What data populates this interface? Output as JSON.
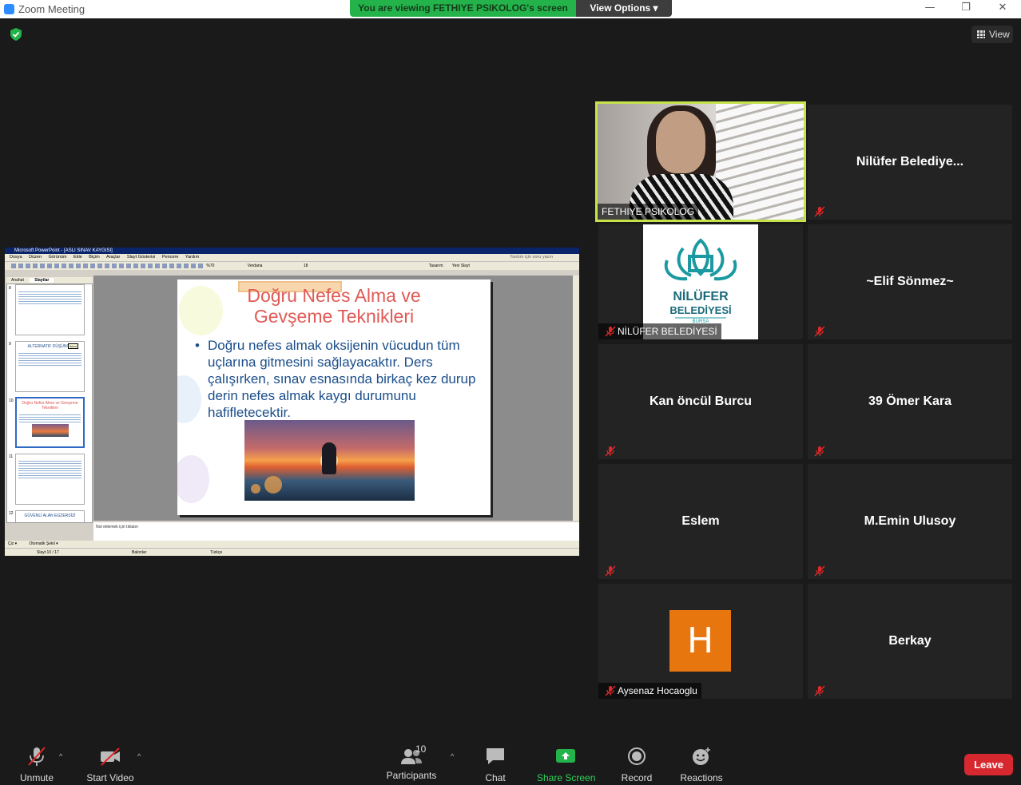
{
  "window": {
    "title": "Zoom Meeting",
    "minimize": "—",
    "restore": "❐",
    "close": "✕"
  },
  "banner": {
    "viewing": "You are viewing FETHIYE PSIKOLOG's screen",
    "view_options": "View Options ▾"
  },
  "top_right": {
    "view_label": "View"
  },
  "shared_screen": {
    "app_title": "Microsoft PowerPoint - [ASLI SINAV KAYGISI]",
    "menu": [
      "Dosya",
      "Düzen",
      "Görünüm",
      "Ekle",
      "Biçim",
      "Araçlar",
      "Slayt Gösterisi",
      "Pencere",
      "Yardım"
    ],
    "help_search": "Yardım için soru yazın",
    "toolbar_zoom": "%70",
    "toolbar_font": "Verdana",
    "toolbar_size": "18",
    "toolbar_design": "Tasarım",
    "toolbar_new_slide": "Yeni Slayt",
    "pane_tabs": [
      "Anahat",
      "Slaytlar"
    ],
    "thumbnails": [
      {
        "num": "8",
        "title": "",
        "red": false,
        "tooltip": ""
      },
      {
        "num": "9",
        "title": "ALTERNATIF DÜŞÜNCE",
        "red": false,
        "tooltip": "İkinci"
      },
      {
        "num": "10",
        "title": "Doğru Nefes Alma ve Gevşeme Teknikleri",
        "red": true,
        "tooltip": ""
      },
      {
        "num": "11",
        "title": "",
        "red": false,
        "tooltip": ""
      },
      {
        "num": "12",
        "title": "GÜVENLİ ALAN EGZERSİZİ",
        "red": false,
        "tooltip": ""
      }
    ],
    "slide": {
      "title_line1": "Doğru Nefes Alma ve",
      "title_line2": "Gevşeme Teknikleri",
      "bullet": "Doğru nefes almak oksijenin vücudun tüm uçlarına gitmesini sağlayacaktır. Ders çalışırken, sınav esnasında birkaç kez durup derin nefes almak kaygı durumunu hafifletecektir."
    },
    "notes_placeholder": "Not eklemek için tıklatın",
    "draw_bar": {
      "draw": "Çiz ▾",
      "autoshapes": "Otomatik Şekil ▾"
    },
    "status": {
      "slide": "Slayt 10 / 17",
      "design": "Balonlar",
      "language": "Türkçe"
    }
  },
  "participants_tiles": [
    {
      "name": "FETHIYE PSIKOLOG",
      "type": "video",
      "muted": false
    },
    {
      "name": "Nilüfer  Belediye...",
      "type": "name",
      "muted": true
    },
    {
      "name": "NİLÜFER BELEDİYESİ",
      "type": "logo",
      "muted": true,
      "logo_line1": "NİLÜFER",
      "logo_line2": "BELEDİYESİ",
      "logo_line3": "BURSA"
    },
    {
      "name": "~Elif Sönmez~",
      "type": "name",
      "muted": true
    },
    {
      "name": "Kan öncül Burcu",
      "type": "name",
      "muted": true
    },
    {
      "name": "39 Ömer Kara",
      "type": "name",
      "muted": true
    },
    {
      "name": "Eslem",
      "type": "name",
      "muted": true
    },
    {
      "name": "M.Emin Ulusoy",
      "type": "name",
      "muted": true
    },
    {
      "name": "Aysenaz Hocaoglu",
      "type": "avatar",
      "muted": true,
      "initial": "H"
    },
    {
      "name": "Berkay",
      "type": "name",
      "muted": true
    }
  ],
  "toolbar": {
    "unmute": "Unmute",
    "start_video": "Start Video",
    "participants": "Participants",
    "participants_count": "10",
    "chat": "Chat",
    "share_screen": "Share Screen",
    "record": "Record",
    "reactions": "Reactions",
    "leave": "Leave",
    "caret": "^"
  },
  "colors": {
    "accent_green": "#23b34a",
    "leave_red": "#d7282f",
    "active_speaker": "#c6e24a",
    "avatar_orange": "#e8760e"
  }
}
